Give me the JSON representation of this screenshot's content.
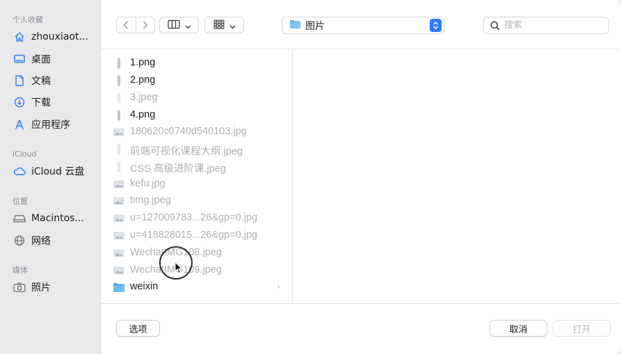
{
  "sidebar": {
    "sections": [
      {
        "title": "个人收藏",
        "items": [
          {
            "label": "zhouxiaot...",
            "icon": "home-icon"
          },
          {
            "label": "桌面",
            "icon": "desktop-icon"
          },
          {
            "label": "文稿",
            "icon": "document-icon"
          },
          {
            "label": "下载",
            "icon": "download-icon"
          },
          {
            "label": "应用程序",
            "icon": "applications-icon"
          }
        ]
      },
      {
        "title": "iCloud",
        "items": [
          {
            "label": "iCloud 云盘",
            "icon": "cloud-icon"
          }
        ]
      },
      {
        "title": "位置",
        "items": [
          {
            "label": "Macintos...",
            "icon": "disk-icon"
          },
          {
            "label": "网络",
            "icon": "network-icon"
          }
        ]
      },
      {
        "title": "媒体",
        "items": [
          {
            "label": "照片",
            "icon": "camera-icon"
          }
        ]
      }
    ]
  },
  "toolbar": {
    "location": "图片",
    "search_placeholder": "搜索",
    "search_value": ""
  },
  "files": [
    {
      "name": "1.png",
      "enabled": true,
      "icon": "png-file-icon"
    },
    {
      "name": "2.png",
      "enabled": true,
      "icon": "png-file-icon"
    },
    {
      "name": "3.jpeg",
      "enabled": false,
      "icon": "jpeg-file-icon"
    },
    {
      "name": "4.png",
      "enabled": true,
      "icon": "png-file-icon"
    },
    {
      "name": "180620c0740d540103.jpg",
      "enabled": false,
      "icon": "image-thumbnail-icon"
    },
    {
      "name": "前端可视化课程大纲.jpeg",
      "enabled": false,
      "icon": "jpeg-file-icon"
    },
    {
      "name": "CSS 高级进阶课.jpeg",
      "enabled": false,
      "icon": "jpeg-file-icon"
    },
    {
      "name": "kefu.jpg",
      "enabled": false,
      "icon": "image-thumbnail-icon"
    },
    {
      "name": "timg.jpeg",
      "enabled": false,
      "icon": "image-thumbnail-icon"
    },
    {
      "name": "u=127009783...26&gp=0.jpg",
      "enabled": false,
      "icon": "image-thumbnail-icon"
    },
    {
      "name": "u=418828015...26&gp=0.jpg",
      "enabled": false,
      "icon": "image-thumbnail-icon"
    },
    {
      "name": "WechatIMG108.jpeg",
      "enabled": false,
      "icon": "image-thumbnail-icon"
    },
    {
      "name": "WechatIMG109.jpeg",
      "enabled": false,
      "icon": "image-thumbnail-icon"
    },
    {
      "name": "weixin",
      "enabled": true,
      "icon": "folder-icon",
      "is_folder": true
    }
  ],
  "bottombar": {
    "options_label": "选项",
    "cancel_label": "取消",
    "open_label": "打开"
  },
  "colors": {
    "accent": "#3478f6",
    "sidebar_icon": "#2f7bf5",
    "folder": "#5ab3f0"
  }
}
